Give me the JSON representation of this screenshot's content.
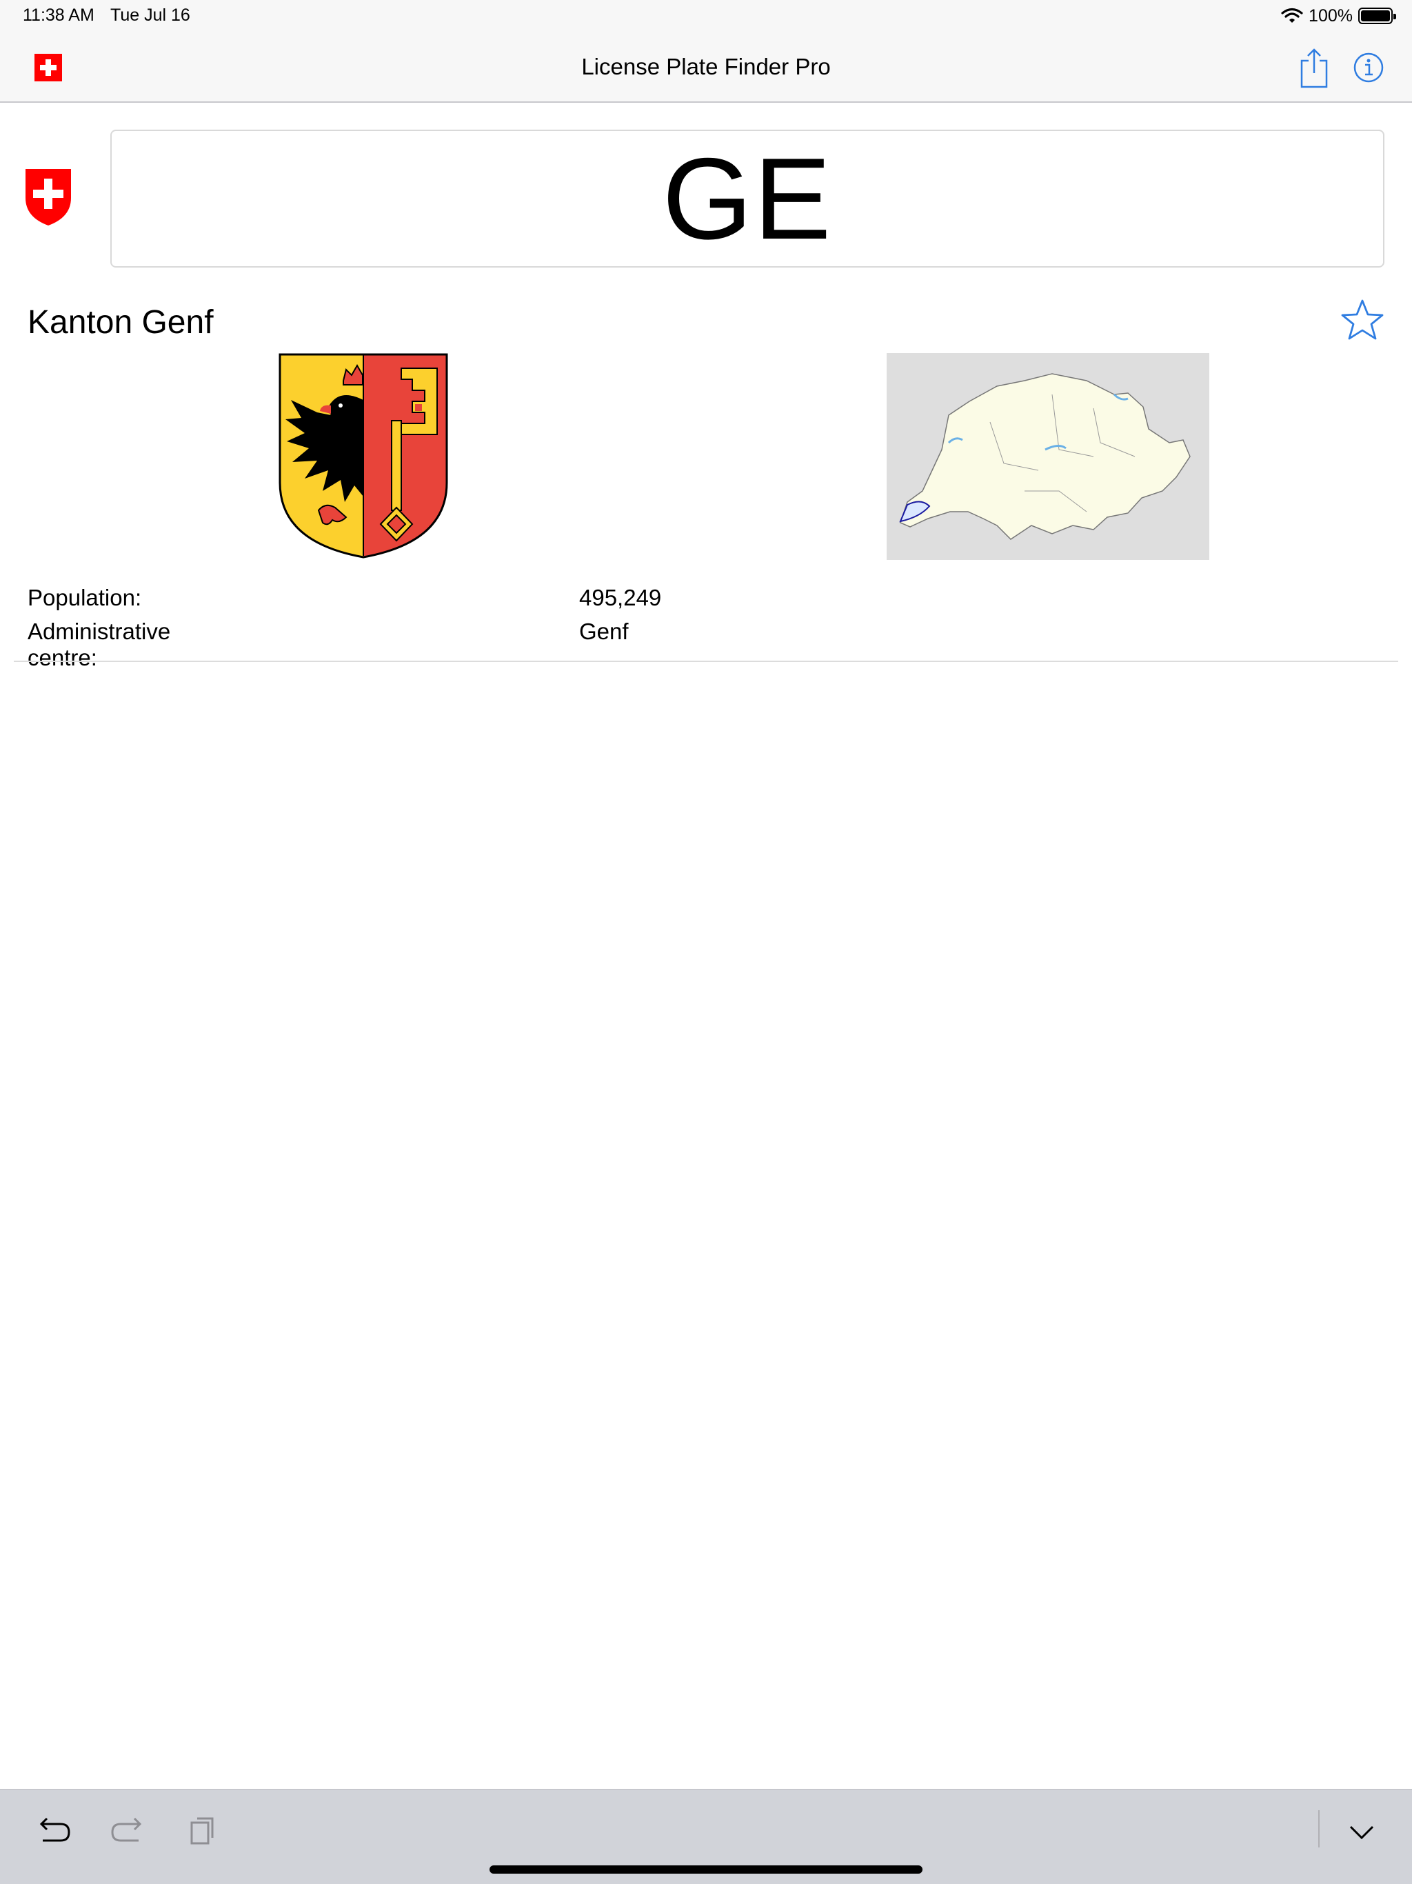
{
  "status_bar": {
    "time": "11:38 AM",
    "date": "Tue Jul 16",
    "battery": "100%"
  },
  "nav": {
    "title": "License Plate Finder Pro"
  },
  "plate": {
    "code": "GE"
  },
  "region": {
    "name": "Kanton Genf"
  },
  "details": {
    "population_label": "Population:",
    "population_value": "495,249",
    "admin_label": "Administrative centre:",
    "admin_value": "Genf"
  },
  "icons": {
    "flag": "swiss-flag-icon",
    "share": "share-icon",
    "info": "info-icon",
    "favorite": "star-outline-icon",
    "undo": "undo-icon",
    "redo": "redo-icon",
    "paste": "paste-icon",
    "dismiss": "chevron-down-icon"
  },
  "colors": {
    "accent": "#2f7de1",
    "swiss_red": "#ff0000",
    "geneva_yellow": "#fcd02d",
    "geneva_red": "#e8443a"
  }
}
